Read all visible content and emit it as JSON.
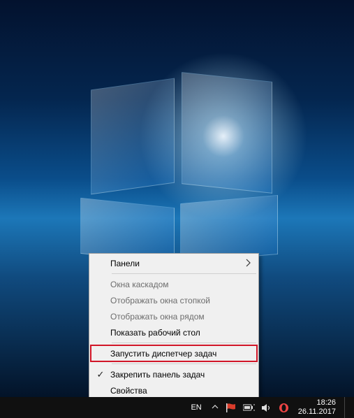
{
  "context_menu": {
    "panels": "Панели",
    "cascade": "Окна каскадом",
    "stack": "Отображать окна стопкой",
    "sidebyside": "Отображать окна рядом",
    "show_desktop": "Показать рабочий стол",
    "task_manager": "Запустить диспетчер задач",
    "lock_taskbar": "Закрепить панель задач",
    "properties": "Свойства"
  },
  "taskbar": {
    "language": "EN",
    "time": "18:26",
    "date": "26.11.2017"
  }
}
